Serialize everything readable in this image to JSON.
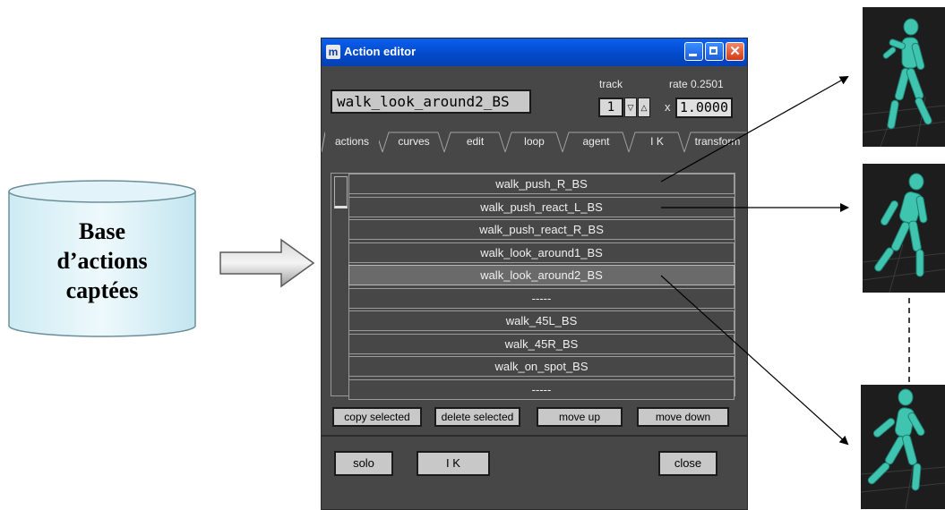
{
  "database": {
    "label_lines": [
      "Base",
      "d’actions",
      "captées"
    ]
  },
  "window": {
    "title": "Action editor",
    "action_name": "walk_look_around2_BS",
    "track_label": "track",
    "track_value": "1",
    "rate_label": "rate  0.2501",
    "multiplier_prefix": "x",
    "multiplier_value": "1.0000",
    "tabs": [
      {
        "label": "actions",
        "active": true
      },
      {
        "label": "curves",
        "active": false
      },
      {
        "label": "edit",
        "active": false
      },
      {
        "label": "loop",
        "active": false
      },
      {
        "label": "agent",
        "active": false
      },
      {
        "label": "I K",
        "active": false
      },
      {
        "label": "transform",
        "active": false
      }
    ],
    "actions": [
      {
        "label": "walk_push_R_BS",
        "selected": false
      },
      {
        "label": "walk_push_react_L_BS",
        "selected": false
      },
      {
        "label": "walk_push_react_R_BS",
        "selected": false
      },
      {
        "label": "walk_look_around1_BS",
        "selected": false
      },
      {
        "label": "walk_look_around2_BS",
        "selected": true
      },
      {
        "label": "-----",
        "selected": false
      },
      {
        "label": "walk_45L_BS",
        "selected": false
      },
      {
        "label": "walk_45R_BS",
        "selected": false
      },
      {
        "label": "walk_on_spot_BS",
        "selected": false
      },
      {
        "label": "-----",
        "selected": false
      }
    ],
    "buttons": {
      "copy_selected": "copy selected",
      "delete_selected": "delete selected",
      "move_up": "move up",
      "move_down": "move down",
      "solo": "solo",
      "ik": "I K",
      "close": "close"
    }
  },
  "colors": {
    "window_bg": "#474747",
    "titlebar": "#0a5ff0",
    "figure": "#3fc4b0",
    "thumbnail_bg": "#1d1d1d"
  }
}
